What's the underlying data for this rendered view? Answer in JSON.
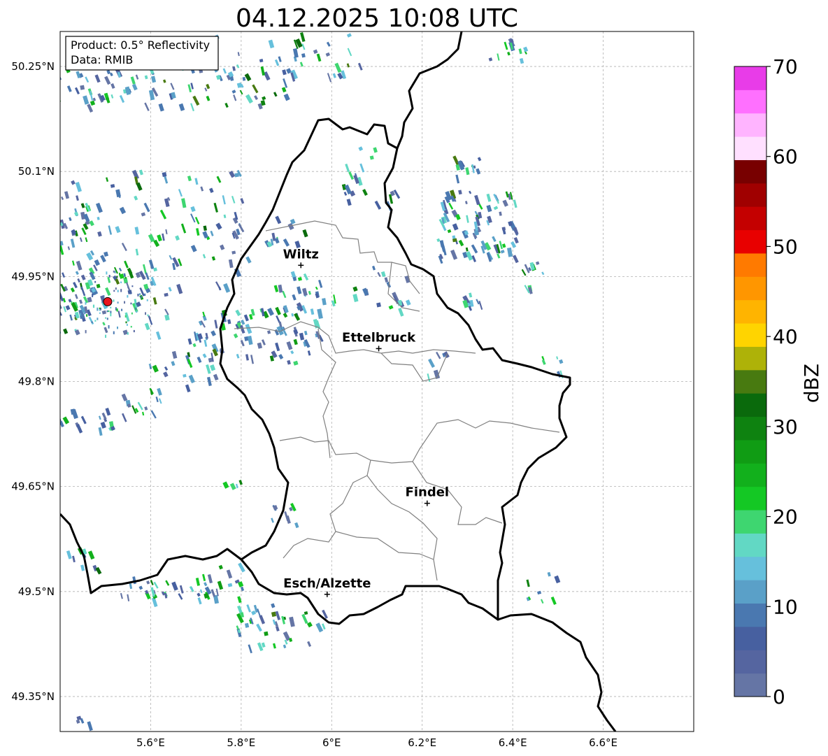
{
  "title": "04.12.2025 10:08 UTC",
  "info_box": {
    "product": "Product: 0.5° Reflectivity",
    "data": "Data: RMIB"
  },
  "map": {
    "lon_range": [
      5.4,
      6.8
    ],
    "lat_range": [
      49.3,
      50.3
    ],
    "x_ticks": [
      {
        "value": 5.6,
        "label": "5.6°E"
      },
      {
        "value": 5.8,
        "label": "5.8°E"
      },
      {
        "value": 6.0,
        "label": "6°E"
      },
      {
        "value": 6.2,
        "label": "6.2°E"
      },
      {
        "value": 6.4,
        "label": "6.4°E"
      },
      {
        "value": 6.6,
        "label": "6.6°E"
      }
    ],
    "y_ticks": [
      {
        "value": 50.25,
        "label": "50.25°N"
      },
      {
        "value": 50.1,
        "label": "50.1°N"
      },
      {
        "value": 49.95,
        "label": "49.95°N"
      },
      {
        "value": 49.8,
        "label": "49.8°N"
      },
      {
        "value": 49.65,
        "label": "49.65°N"
      },
      {
        "value": 49.5,
        "label": "49.5°N"
      },
      {
        "value": 49.35,
        "label": "49.35°N"
      }
    ],
    "cities": [
      {
        "name": "Wiltz",
        "lon": 5.932,
        "lat": 49.966
      },
      {
        "name": "Ettelbruck",
        "lon": 6.104,
        "lat": 49.847
      },
      {
        "name": "Findel",
        "lon": 6.211,
        "lat": 49.626
      },
      {
        "name": "Esch/Alzette",
        "lon": 5.99,
        "lat": 49.496
      }
    ],
    "radar_site": {
      "lon": 5.505,
      "lat": 49.914,
      "color": "#e8141e"
    }
  },
  "colorbar": {
    "label": "dBZ",
    "min": 0,
    "max": 70,
    "step": 2.5,
    "colors": [
      "#6575a5",
      "#5565a0",
      "#4760a0",
      "#4a78b0",
      "#5aa0c8",
      "#66c0dc",
      "#62d8c4",
      "#3ed670",
      "#14c824",
      "#12b01c",
      "#109c14",
      "#0e8210",
      "#0a6a0c",
      "#487a10",
      "#aeb208",
      "#ffd400",
      "#ffb400",
      "#ff9600",
      "#ff7a00",
      "#e80000",
      "#c40000",
      "#a00000",
      "#780000",
      "#ffe0ff",
      "#ffb4ff",
      "#ff70ff",
      "#e83ce8"
    ],
    "tick_values": [
      0,
      10,
      20,
      30,
      40,
      50,
      60,
      70
    ],
    "tick_labels": [
      "0",
      "10",
      "20",
      "30",
      "40",
      "50",
      "60",
      "70"
    ]
  }
}
